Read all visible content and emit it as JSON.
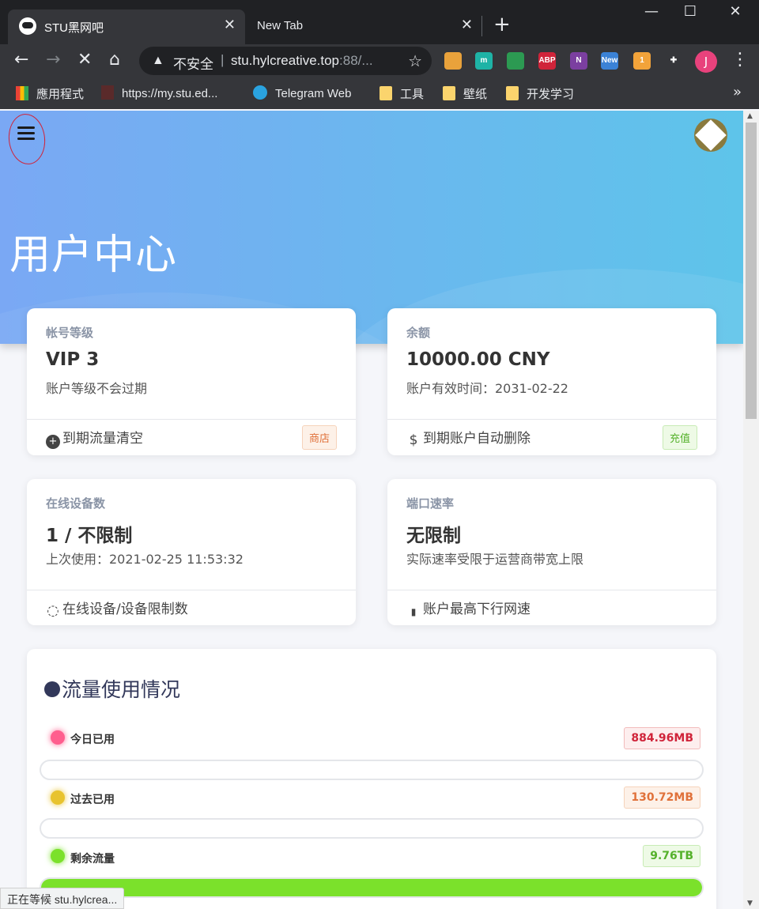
{
  "browser": {
    "tabs": [
      {
        "title": "STU黑网吧",
        "close": "✕"
      },
      {
        "title": "New Tab",
        "close": "✕"
      }
    ],
    "new_tab": "+",
    "window_controls": {
      "minimize": "—",
      "maximize": "☐",
      "close": "✕"
    },
    "nav": {
      "back": "←",
      "forward": "→",
      "stop": "✕",
      "home": "⌂"
    },
    "omnibox": {
      "warning": "▲",
      "insecure_label": "不安全",
      "separator": "|",
      "host": "stu.hylcreative.top",
      "rest": ":88/...",
      "star": "☆"
    },
    "extensions": [
      {
        "name": "photos-extension-icon",
        "label": "",
        "color": "#e9a23b"
      },
      {
        "name": "m-extension-icon",
        "label": "m",
        "color": "#1eb3a6"
      },
      {
        "name": "green-extension-icon",
        "label": "",
        "color": "#2c9a52"
      },
      {
        "name": "abp-extension-icon",
        "label": "ABP",
        "color": "#d0243a"
      },
      {
        "name": "onenote-extension-icon",
        "label": "N",
        "color": "#7b3fa0"
      },
      {
        "name": "new-extension-icon",
        "label": "New",
        "color": "#3b82d6"
      },
      {
        "name": "badge-extension-icon",
        "label": "1",
        "color": "#f2a33a"
      },
      {
        "name": "puzzle-extension-icon",
        "label": "✚",
        "color": "#35363a"
      }
    ],
    "profile_initial": "J",
    "menu": "⋮",
    "bookmarks": [
      {
        "label": "應用程式"
      },
      {
        "label": "https://my.stu.ed..."
      },
      {
        "label": "Telegram Web"
      },
      {
        "label": "工具"
      },
      {
        "label": "壁纸"
      },
      {
        "label": "开发学习"
      }
    ],
    "bookmarks_more": "»",
    "status": "正在等候 stu.hylcrea..."
  },
  "page": {
    "title": "用户中心",
    "cards": [
      {
        "label": "帐号等级",
        "value": "VIP 3",
        "sub": "账户等级不会过期",
        "footer": "到期流量清空",
        "footer_icon": "+",
        "badge": "商店"
      },
      {
        "label": "余额",
        "value": "10000.00 CNY",
        "sub": "账户有效时间：2031-02-22",
        "footer": "到期账户自动删除",
        "footer_icon": "$",
        "badge": "充值"
      },
      {
        "label": "在线设备数",
        "value": "1 / 不限制",
        "sub": "上次使用：2021-02-25 11:53:32",
        "footer": "在线设备/设备限制数",
        "footer_icon": "◌"
      },
      {
        "label": "端口速率",
        "value": "无限制",
        "sub": "实际速率受限于运营商带宽上限",
        "footer": "账户最高下行网速",
        "footer_icon": "▮"
      }
    ],
    "traffic": {
      "heading": "流量使用情况",
      "rows": [
        {
          "label": "今日已用",
          "value": "884.96MB",
          "dot_color": "#ff5e8e",
          "text_color": "#d0243a",
          "bg": "#fdeeee",
          "border": "#f2bcbc",
          "fill_fraction": 0.0
        },
        {
          "label": "过去已用",
          "value": "130.72MB",
          "dot_color": "#e8c32e",
          "text_color": "#e0713a",
          "bg": "#fdf1e8",
          "border": "#f6d3bb",
          "fill_fraction": 0.0
        },
        {
          "label": "剩余流量",
          "value": "9.76TB",
          "dot_color": "#7be12b",
          "text_color": "#55b12b",
          "bg": "#eefae6",
          "border": "#c8ebb5",
          "fill_fraction": 1.0
        }
      ]
    }
  }
}
